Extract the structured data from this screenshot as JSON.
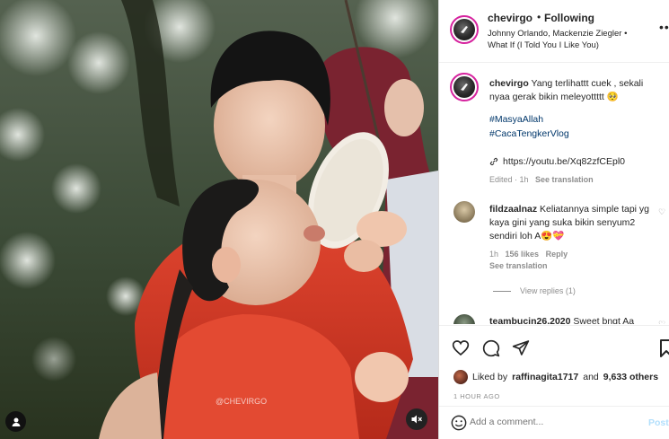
{
  "header": {
    "username": "chevirgo",
    "separator": "•",
    "follow_status": "Following",
    "audio": "Johnny Orlando, Mackenzie Ziegler • What If (I Told You I Like You)",
    "more": "•••"
  },
  "media": {
    "watermark": "@CHEVIRGO",
    "user_tag_icon": "person-icon",
    "mute_icon": "speaker-muted-icon"
  },
  "caption": {
    "username": "chevirgo",
    "text": "Yang terlihattt cuek , sekali nyaa gerak bikin meleyottttt 🥺",
    "hashtag1": "#MasyaAllah",
    "hashtag2": "#CacaTengkerVlog",
    "link": "https://youtu.be/Xq82zfCEpl0",
    "meta_time": "Edited · 1h",
    "see_translation": "See translation"
  },
  "comments": [
    {
      "username": "fildzaalnaz",
      "text": "Keliatannya simple tapi yg kaya gini yang suka bikin senyum2 sendiri loh A😍💝",
      "time": "1h",
      "likes": "156 likes",
      "reply": "Reply",
      "see_translation": "See translation",
      "view_replies": "View replies (1)"
    },
    {
      "username": "teambucin26.2020",
      "text": "Sweet bngt Aa"
    }
  ],
  "actions": {
    "like_icon": "heart-icon",
    "comment_icon": "comment-icon",
    "share_icon": "paper-plane-icon",
    "save_icon": "bookmark-icon"
  },
  "likes": {
    "prefix": "Liked by",
    "user": "raffinagita1717",
    "and": "and",
    "others": "9,633 others"
  },
  "timestamp": "1 HOUR AGO",
  "add_comment": {
    "placeholder": "Add a comment...",
    "post_label": "Post"
  }
}
